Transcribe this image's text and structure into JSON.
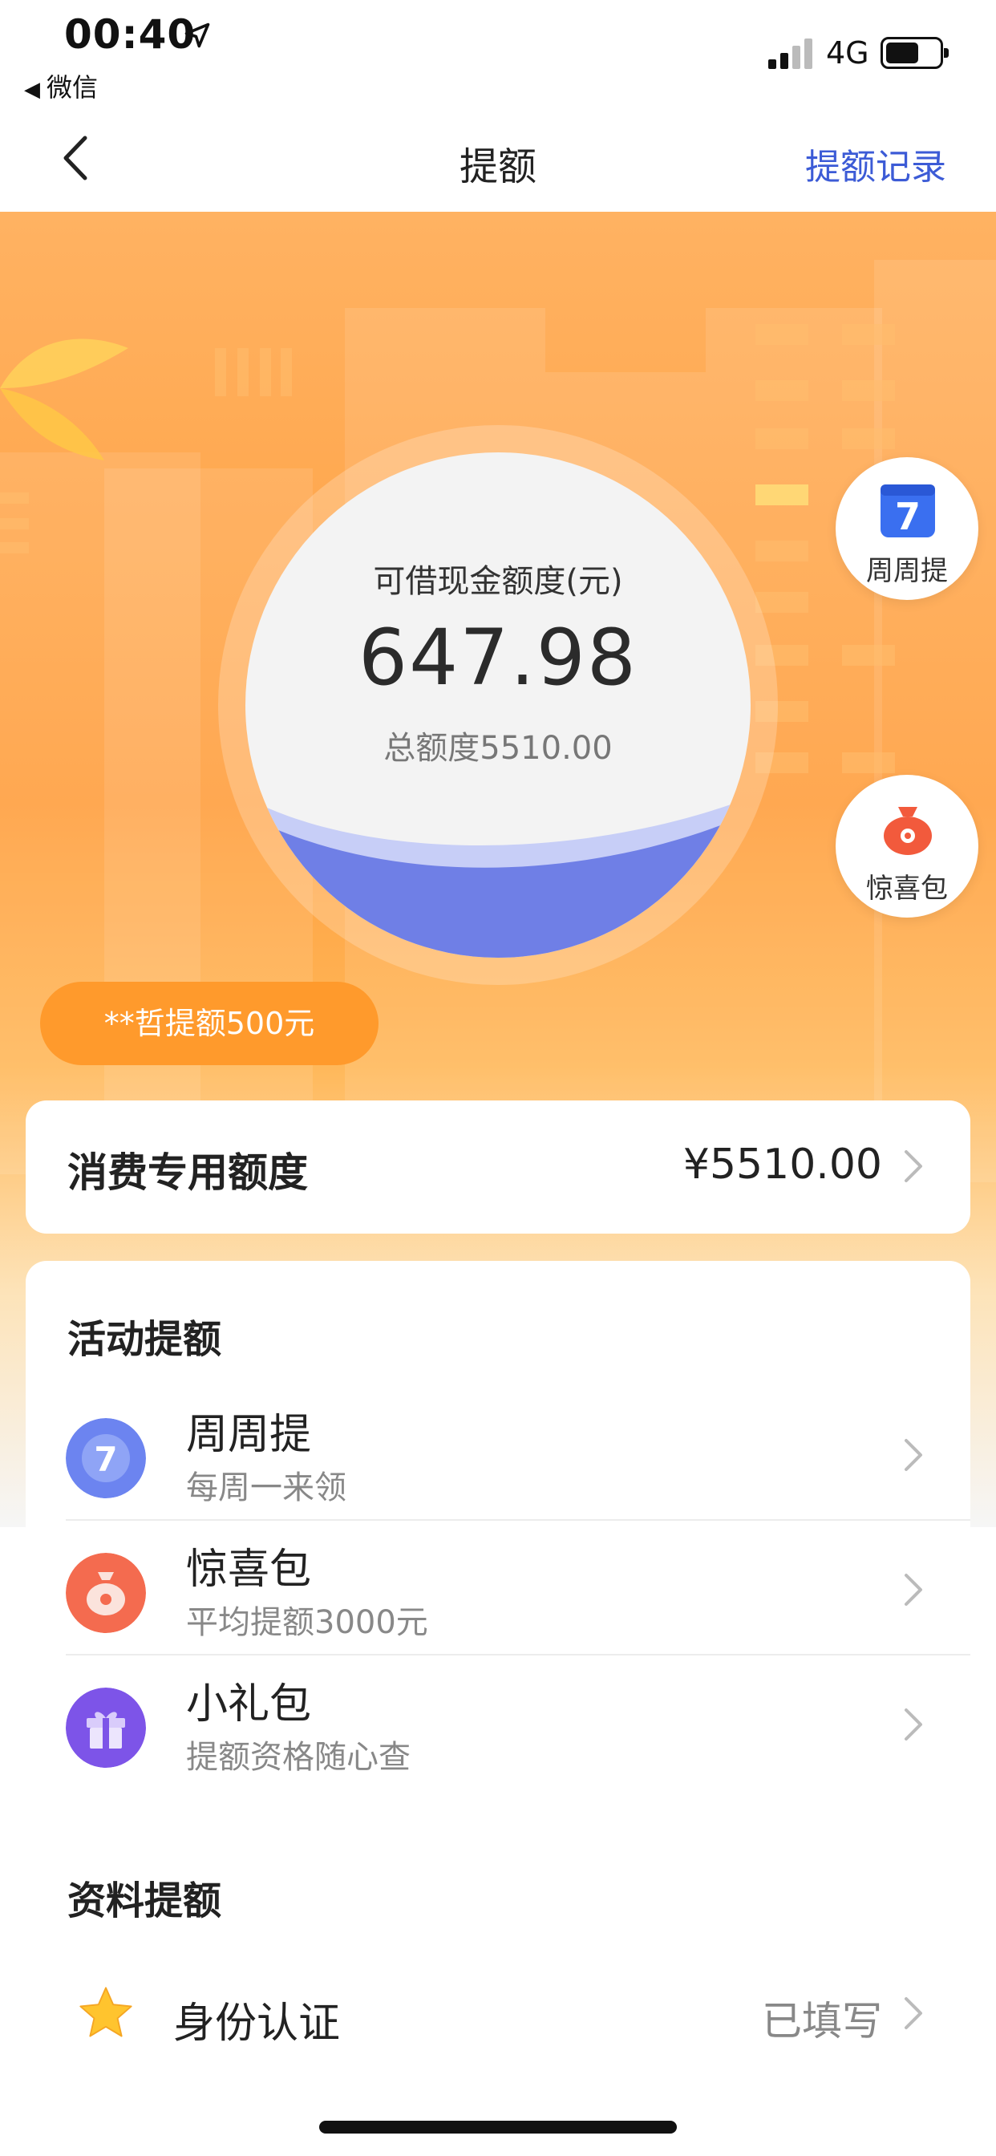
{
  "status_bar": {
    "time": "00:40",
    "back_app": "微信",
    "network": "4G"
  },
  "nav": {
    "title": "提额",
    "right_link": "提额记录"
  },
  "hero": {
    "circle_label": "可借现金额度(元)",
    "available_amount": "647.98",
    "total_label": "总额度5510.00",
    "fill_fraction": 0.18,
    "float_buttons": [
      {
        "label": "周周提",
        "icon": "calendar-7-icon"
      },
      {
        "label": "惊喜包",
        "icon": "money-bag-icon"
      }
    ],
    "promo": "**哲提额500元"
  },
  "quota_card": {
    "title": "消费专用额度",
    "amount": "¥5510.00"
  },
  "activity": {
    "title": "活动提额",
    "items": [
      {
        "title": "周周提",
        "subtitle": "每周一来领",
        "icon": "weekly-7-icon",
        "color": "#6c84f0"
      },
      {
        "title": "惊喜包",
        "subtitle": "平均提额3000元",
        "icon": "surprise-bag-icon",
        "color": "#f46b4f"
      },
      {
        "title": "小礼包",
        "subtitle": "提额资格随心查",
        "icon": "gift-box-icon",
        "color": "#7d54e8"
      }
    ]
  },
  "info": {
    "title": "资料提额",
    "items": [
      {
        "title": "身份认证",
        "status": "已填写",
        "icon": "star-icon"
      }
    ]
  },
  "colors": {
    "accent_blue": "#3c5bd6",
    "hero_orange": "#ff9f3e",
    "wave_blue": "#6f7fe6"
  }
}
